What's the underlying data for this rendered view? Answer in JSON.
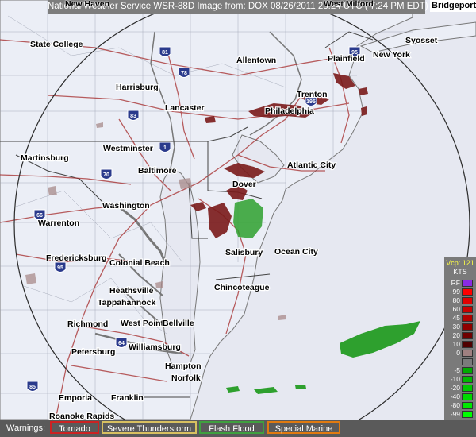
{
  "title": {
    "text": "National Weather Service WSR-88D Image from: DOX 08/26/2011  23:24 UTC  ( 7:24 PM EDT)",
    "left_city": "New Haven",
    "right_city": "West Milford",
    "corner_city": "Bridgeport"
  },
  "places": {
    "state_college": "State College",
    "allentown": "Allentown",
    "plainfield": "Plainfield",
    "new_york": "New York",
    "syosset": "Syosset",
    "harrisburg": "Harrisburg",
    "lancaster": "Lancaster",
    "trenton": "Trenton",
    "philadelphia": "Philadelphia",
    "westminster": "Westminster",
    "martinsburg": "Martinsburg",
    "baltimore": "Baltimore",
    "atlantic_city": "Atlantic City",
    "dover": "Dover",
    "washington": "Washington",
    "warrenton": "Warrenton",
    "fredericksburg": "Fredericksburg",
    "colonial_beach": "Colonial Beach",
    "salisbury": "Salisbury",
    "ocean_city": "Ocean City",
    "chincoteague": "Chincoteague",
    "heathsville": "Heathsville",
    "tappahannock": "Tappahannock",
    "richmond": "Richmond",
    "west_point": "West Point",
    "bellville": "Bellville",
    "petersburg": "Petersburg",
    "williamsburg": "Williamsburg",
    "hampton": "Hampton",
    "norfolk": "Norfolk",
    "emporia": "Emporia",
    "franklin": "Franklin",
    "roanoke_rapids": "Roanoke Rapids"
  },
  "highway_shields": [
    "81",
    "78",
    "83",
    "70",
    "95",
    "66",
    "195",
    "64",
    "85",
    "95",
    "1"
  ],
  "warnings": {
    "label": "Warnings:",
    "items": [
      {
        "label": "Tornado",
        "color": "#cc2222"
      },
      {
        "label": "Severe Thunderstorm",
        "color": "#d8c060"
      },
      {
        "label": "Flash Flood",
        "color": "#3fa03f"
      },
      {
        "label": "Special Marine",
        "color": "#e07a10"
      }
    ]
  },
  "legend": {
    "vcp": "Vcp: 121",
    "unit": "KTS",
    "entries": [
      {
        "label": "RF",
        "color": "#8a2be2"
      },
      {
        "label": "99",
        "color": "#ff0000"
      },
      {
        "label": "80",
        "color": "#e00000"
      },
      {
        "label": "60",
        "color": "#c80000"
      },
      {
        "label": "45",
        "color": "#b00000"
      },
      {
        "label": "30",
        "color": "#900000"
      },
      {
        "label": "20",
        "color": "#700000"
      },
      {
        "label": "10",
        "color": "#500000"
      },
      {
        "label": "0",
        "color": "#a08080"
      },
      {
        "label": "",
        "color": "#7a7a7a"
      },
      {
        "label": "-5",
        "color": "#00aa00"
      },
      {
        "label": "-10",
        "color": "#00b800"
      },
      {
        "label": "-20",
        "color": "#00c800"
      },
      {
        "label": "-40",
        "color": "#00d800"
      },
      {
        "label": "-80",
        "color": "#00e800"
      },
      {
        "label": "-99",
        "color": "#00ff00"
      },
      {
        "label": "ND",
        "color": "#444444"
      }
    ]
  }
}
